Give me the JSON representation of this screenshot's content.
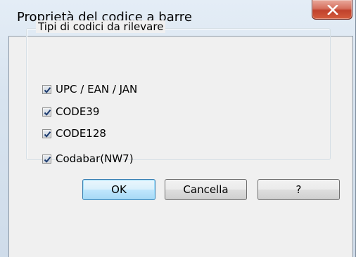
{
  "window": {
    "title": "Proprietà del codice a barre",
    "close_icon": "close-icon"
  },
  "group": {
    "legend": "Tipi di codici da rilevare",
    "options": [
      {
        "label": "UPC / EAN / JAN",
        "checked": true
      },
      {
        "label": "CODE39",
        "checked": true
      },
      {
        "label": "CODE128",
        "checked": true
      },
      {
        "label": "Codabar(NW7)",
        "checked": true
      }
    ]
  },
  "buttons": {
    "ok": "OK",
    "cancel": "Cancella",
    "help": "?"
  },
  "colors": {
    "titlebar_bg": "#dbe6f1",
    "client_bg": "#f0f0f0",
    "close_button": "#c7503a",
    "check_mark": "#1c3a6e",
    "default_button_border": "#3c7fb1"
  }
}
